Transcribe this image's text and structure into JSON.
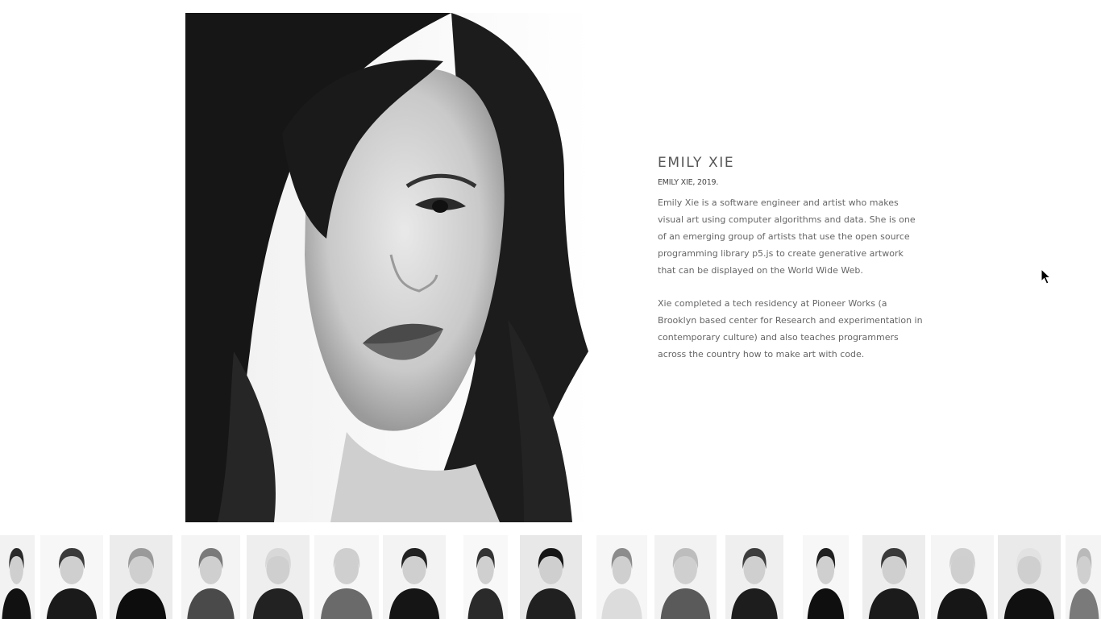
{
  "profile": {
    "name": "EMILY XIE",
    "caption": "EMILY XIE, 2019.",
    "paragraphs": [
      "Emily Xie is a software engineer and artist who makes visual art using computer algorithms and data. She is one of an emerging group of artists that use the open source programming library p5.js to create generative artwork that can be displayed on the World Wide Web.",
      "Xie completed a tech residency at Pioneer Works (a Brooklyn based center for Research and experimentation in contemporary culture) and also teaches programmers across the country how to make art with code."
    ]
  },
  "thumbnails": [
    {
      "name": "portrait-thumbnail-1",
      "bg": "#f2f2f2",
      "hair": "#2a2a2a",
      "cloth": "#111"
    },
    {
      "name": "portrait-thumbnail-2",
      "bg": "#f7f7f7",
      "hair": "#3a3a3a",
      "cloth": "#1a1a1a"
    },
    {
      "name": "portrait-thumbnail-3",
      "bg": "#ececec",
      "hair": "#9a9a9a",
      "cloth": "#0d0d0d"
    },
    {
      "name": "portrait-thumbnail-4",
      "bg": "#f4f4f4",
      "hair": "#7a7a7a",
      "cloth": "#4a4a4a"
    },
    {
      "name": "portrait-thumbnail-5",
      "bg": "#eeeeee",
      "hair": "#d8d8d8",
      "cloth": "#222"
    },
    {
      "name": "portrait-thumbnail-6",
      "bg": "#f6f6f6",
      "hair": "#cfcfcf",
      "cloth": "#6a6a6a"
    },
    {
      "name": "portrait-thumbnail-7",
      "bg": "#f3f3f3",
      "hair": "#222",
      "cloth": "#151515"
    },
    {
      "name": "portrait-thumbnail-8",
      "bg": "#f8f8f8",
      "hair": "#333",
      "cloth": "#2a2a2a"
    },
    {
      "name": "portrait-thumbnail-9",
      "bg": "#e8e8e8",
      "hair": "#161616",
      "cloth": "#202020"
    },
    {
      "name": "portrait-thumbnail-10",
      "bg": "#f6f6f6",
      "hair": "#8c8c8c",
      "cloth": "#dcdcdc"
    },
    {
      "name": "portrait-thumbnail-11",
      "bg": "#f2f2f2",
      "hair": "#bdbdbd",
      "cloth": "#5a5a5a"
    },
    {
      "name": "portrait-thumbnail-12",
      "bg": "#efefef",
      "hair": "#3d3d3d",
      "cloth": "#1d1d1d"
    },
    {
      "name": "portrait-thumbnail-13",
      "bg": "#f7f7f7",
      "hair": "#202020",
      "cloth": "#0f0f0f"
    },
    {
      "name": "portrait-thumbnail-14",
      "bg": "#ededed",
      "hair": "#3a3a3a",
      "cloth": "#1b1b1b"
    },
    {
      "name": "portrait-thumbnail-15",
      "bg": "#f5f5f5",
      "hair": "#d0d0d0",
      "cloth": "#161616"
    },
    {
      "name": "portrait-thumbnail-16",
      "bg": "#eaeaea",
      "hair": "#e2e2e2",
      "cloth": "#101010"
    },
    {
      "name": "portrait-thumbnail-17",
      "bg": "#f4f4f4",
      "hair": "#b9b9b9",
      "cloth": "#7a7a7a"
    }
  ]
}
